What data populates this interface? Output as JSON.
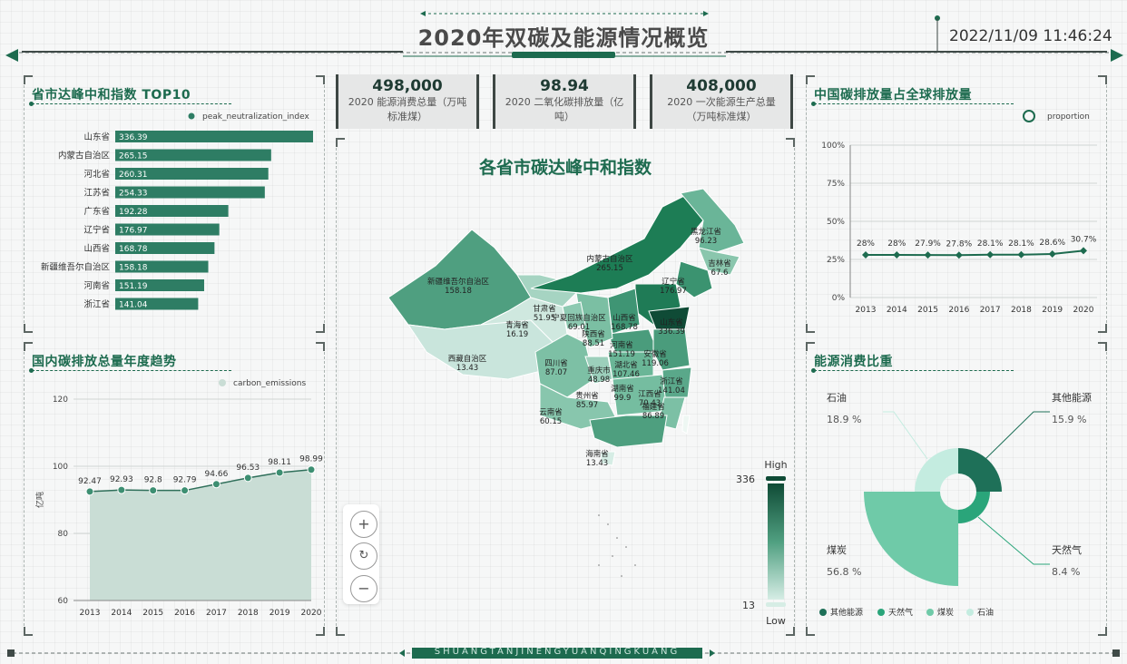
{
  "header": {
    "title": "2020年双碳及能源情况概览",
    "datetime": "2022/11/09 11:46:24",
    "footer": "SHUANGTANJINENGYUANQINGKUANG"
  },
  "kpis": [
    {
      "value": "498,000",
      "label": "2020 能源消费总量（万吨标准煤）"
    },
    {
      "value": "98.94",
      "label": "2020 二氧化碳排放量（亿吨）"
    },
    {
      "value": "408,000",
      "label": "2020 一次能源生产总量（万吨标准煤）"
    }
  ],
  "top10": {
    "title": "省市达峰中和指数 TOP10",
    "legend": "peak_neutralization_index",
    "color": "#2e7d64",
    "max": 336.39,
    "items": [
      {
        "name": "山东省",
        "value": 336.39
      },
      {
        "name": "内蒙古自治区",
        "value": 265.15
      },
      {
        "name": "河北省",
        "value": 260.31
      },
      {
        "name": "江苏省",
        "value": 254.33
      },
      {
        "name": "广东省",
        "value": 192.28
      },
      {
        "name": "辽宁省",
        "value": 176.97
      },
      {
        "name": "山西省",
        "value": 168.78
      },
      {
        "name": "新疆维吾尔自治区",
        "value": 158.18
      },
      {
        "name": "河南省",
        "value": 151.19
      },
      {
        "name": "浙江省",
        "value": 141.04
      }
    ]
  },
  "emissions": {
    "title": "国内碳排放总量年度趋势",
    "legend": "carbon_emissions",
    "ylabel": "亿吨",
    "ymin": 60,
    "ymax": 120,
    "yticks": [
      60,
      80,
      100,
      120
    ],
    "years": [
      "2013",
      "2014",
      "2015",
      "2016",
      "2017",
      "2018",
      "2019",
      "2020"
    ],
    "values": [
      92.47,
      92.93,
      92.8,
      92.79,
      94.66,
      96.53,
      98.11,
      98.99
    ]
  },
  "map": {
    "title": "各省市碳达峰中和指数",
    "high_label": "High",
    "low_label": "Low",
    "max_label": "336",
    "min_label": "13",
    "zoom_in": "+",
    "reset": "↻",
    "zoom_out": "−",
    "regions": [
      {
        "name": "新疆维吾尔自治区",
        "value": "158.18"
      },
      {
        "name": "西藏自治区",
        "value": "13.43"
      },
      {
        "name": "青海省",
        "value": "16.19"
      },
      {
        "name": "甘肃省",
        "value": "51.95"
      },
      {
        "name": "宁夏回族自治区",
        "value": "69.01"
      },
      {
        "name": "陕西省",
        "value": "88.51"
      },
      {
        "name": "内蒙古自治区",
        "value": "265.15"
      },
      {
        "name": "黑龙江省",
        "value": "96.23"
      },
      {
        "name": "吉林省",
        "value": "67.6"
      },
      {
        "name": "辽宁省",
        "value": "176.97"
      },
      {
        "name": "山西省",
        "value": "168.78"
      },
      {
        "name": "山东省",
        "value": "336.39"
      },
      {
        "name": "河南省",
        "value": "151.19"
      },
      {
        "name": "四川省",
        "value": "87.07"
      },
      {
        "name": "重庆市",
        "value": "48.98"
      },
      {
        "name": "湖北省",
        "value": "107.46"
      },
      {
        "name": "湖南省",
        "value": "99.9"
      },
      {
        "name": "江西省",
        "value": "70.43"
      },
      {
        "name": "贵州省",
        "value": "85.97"
      },
      {
        "name": "云南省",
        "value": "60.15"
      },
      {
        "name": "福建省",
        "value": "86.89"
      },
      {
        "name": "浙江省",
        "value": "141.04"
      },
      {
        "name": "安徽省",
        "value": "119.06"
      },
      {
        "name": "海南省",
        "value": "13.43"
      }
    ]
  },
  "share": {
    "title": "中国碳排放量占全球排放量",
    "legend": "proportion",
    "yticks": [
      "0%",
      "25%",
      "50%",
      "75%",
      "100%"
    ],
    "years": [
      "2013",
      "2014",
      "2015",
      "2016",
      "2017",
      "2018",
      "2019",
      "2020"
    ],
    "values": [
      28,
      28,
      27.9,
      27.8,
      28.1,
      28.1,
      28.6,
      30.7
    ],
    "labels": [
      "28%",
      "28%",
      "27.9%",
      "27.8%",
      "28.1%",
      "28.1%",
      "28.6%",
      "30.7%"
    ]
  },
  "energy": {
    "title": "能源消费比重",
    "items": [
      {
        "name": "其他能源",
        "pct": "15.9 %",
        "value": 15.9,
        "color": "#1e7058"
      },
      {
        "name": "天然气",
        "pct": "8.4 %",
        "value": 8.4,
        "color": "#2aa57a"
      },
      {
        "name": "煤炭",
        "pct": "56.8 %",
        "value": 56.8,
        "color": "#6fcaa8"
      },
      {
        "name": "石油",
        "pct": "18.9 %",
        "value": 18.9,
        "color": "#c4ece0"
      }
    ]
  }
}
